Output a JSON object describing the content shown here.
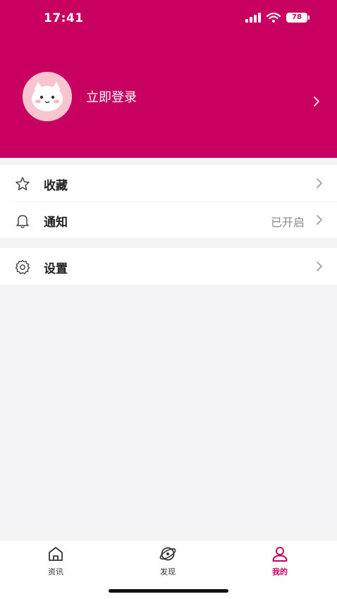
{
  "status_bar": {
    "time": "17:41",
    "battery": "78",
    "signal_icon": "cellular-signal-icon",
    "wifi_icon": "wifi-icon"
  },
  "colors": {
    "brand": "#c8005f",
    "background": "#f4f4f6",
    "card": "#ffffff",
    "text_primary": "#222222",
    "text_secondary": "#8a8a8e"
  },
  "profile": {
    "avatar_icon": "cat-avatar-icon",
    "login_label": "立即登录"
  },
  "menu": {
    "favorites": {
      "icon": "star-icon",
      "label": "收藏"
    },
    "notifications": {
      "icon": "bell-icon",
      "label": "通知",
      "value": "已开启"
    },
    "settings": {
      "icon": "gear-icon",
      "label": "设置"
    }
  },
  "tabbar": {
    "tabs": [
      {
        "icon": "home-icon",
        "label": "资讯",
        "active": false
      },
      {
        "icon": "compass-icon",
        "label": "发现",
        "active": false
      },
      {
        "icon": "user-icon",
        "label": "我的",
        "active": true
      }
    ]
  }
}
